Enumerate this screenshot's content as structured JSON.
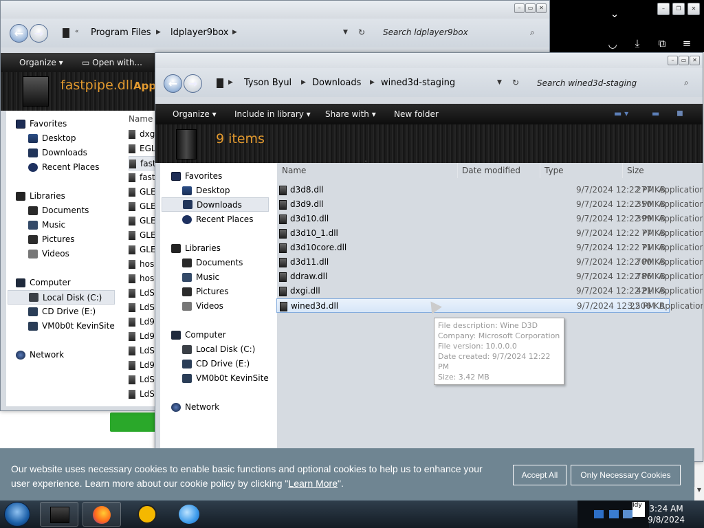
{
  "browser": {
    "chevron_icon": "chevron-down-icon"
  },
  "win1": {
    "path": [
      "Program Files",
      "ldplayer9box"
    ],
    "search_placeholder": "Search ldplayer9box",
    "cmd": {
      "organize": "Organize",
      "open_with": "Open with..."
    },
    "preview_title": "fastpipe.dll",
    "preview_sub": "Appl",
    "col_name": "Name",
    "nav": {
      "favorites": "Favorites",
      "desktop": "Desktop",
      "downloads": "Downloads",
      "recent": "Recent Places",
      "libraries": "Libraries",
      "documents": "Documents",
      "music": "Music",
      "pictures": "Pictures",
      "videos": "Videos",
      "computer": "Computer",
      "local_disk": "Local Disk (C:)",
      "cd_drive": "CD Drive (E:)",
      "vm": "VM0b0t KevinSite",
      "network": "Network"
    },
    "files": [
      "dxg",
      "EGL",
      "fast",
      "fast",
      "GLE",
      "GLE",
      "GLE",
      "GLE",
      "GLE",
      "hos",
      "hos",
      "LdS",
      "LdS",
      "Ld9",
      "Ld9",
      "LdS",
      "Ld9",
      "LdS",
      "LdS"
    ]
  },
  "win2": {
    "path": [
      "Tyson Byul",
      "Downloads",
      "wined3d-staging"
    ],
    "search_placeholder": "Search wined3d-staging",
    "cmd": {
      "organize": "Organize",
      "include": "Include in library",
      "share": "Share with",
      "new_folder": "New folder"
    },
    "item_count": "9 items",
    "columns": {
      "name": "Name",
      "date": "Date modified",
      "type": "Type",
      "size": "Size"
    },
    "nav": {
      "favorites": "Favorites",
      "desktop": "Desktop",
      "downloads": "Downloads",
      "recent": "Recent Places",
      "libraries": "Libraries",
      "documents": "Documents",
      "music": "Music",
      "pictures": "Pictures",
      "videos": "Videos",
      "computer": "Computer",
      "local_disk": "Local Disk (C:)",
      "cd_drive": "CD Drive (E:)",
      "vm": "VM0b0t KevinSite",
      "network": "Network"
    },
    "files": [
      {
        "name": "d3d8.dll",
        "date": "9/7/2024 12:22 PM",
        "type": "Application extens...",
        "size": "277 KB"
      },
      {
        "name": "d3d9.dll",
        "date": "9/7/2024 12:22 PM",
        "type": "Application extens...",
        "size": "350 KB"
      },
      {
        "name": "d3d10.dll",
        "date": "9/7/2024 12:22 PM",
        "type": "Application extens...",
        "size": "399 KB"
      },
      {
        "name": "d3d10_1.dll",
        "date": "9/7/2024 12:22 PM",
        "type": "Application extens...",
        "size": "77 KB"
      },
      {
        "name": "d3d10core.dll",
        "date": "9/7/2024 12:22 PM",
        "type": "Application extens...",
        "size": "71 KB"
      },
      {
        "name": "d3d11.dll",
        "date": "9/7/2024 12:22 PM",
        "type": "Application extens...",
        "size": "700 KB"
      },
      {
        "name": "ddraw.dll",
        "date": "9/7/2024 12:22 PM",
        "type": "Application extens...",
        "size": "786 KB"
      },
      {
        "name": "dxgi.dll",
        "date": "9/7/2024 12:22 PM",
        "type": "Application extens...",
        "size": "421 KB"
      },
      {
        "name": "wined3d.dll",
        "date": "9/7/2024 12:22 PM",
        "type": "Application extens...",
        "size": "3,506 KB"
      }
    ],
    "tooltip": [
      "File description: Wine D3D",
      "Company: Microsoft Corporation",
      "File version: 10.0.0.0",
      "Date created: 9/7/2024 12:22 PM",
      "Size: 3.42 MB"
    ]
  },
  "cookie": {
    "text_before": "Our website uses necessary cookies to enable basic functions and optional cookies to help us to enhance your user experience. Learn more about our cookie policy by clicking \"",
    "link": "Learn More",
    "text_after": "\".",
    "accept": "Accept All",
    "necessary": "Only Necessary Cookies"
  },
  "taskbar": {
    "time": "3:24 AM",
    "date": "9/8/2024",
    "tray_label": "Idy"
  }
}
